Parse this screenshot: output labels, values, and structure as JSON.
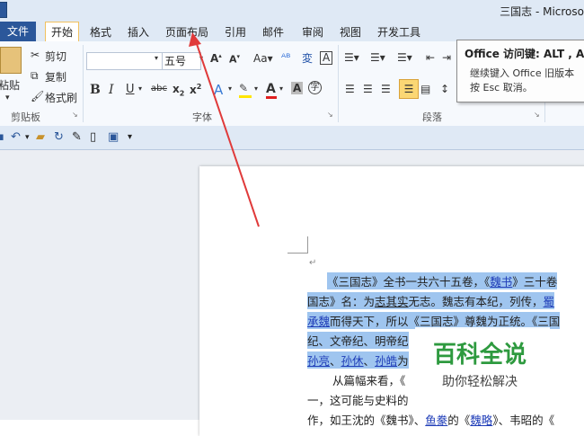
{
  "window": {
    "title": "三国志 - Microso"
  },
  "tabs": [
    "文件",
    "开始",
    "格式",
    "插入",
    "页面布局",
    "引用",
    "邮件",
    "审阅",
    "视图",
    "开发工具"
  ],
  "clipboard": {
    "paste": "粘贴",
    "cut": "剪切",
    "copy": "复制",
    "format_painter": "格式刷",
    "group": "剪贴板"
  },
  "font": {
    "size": "五号",
    "group": "字体"
  },
  "paragraph": {
    "group": "段落"
  },
  "tooltip": {
    "title": "Office 访问键: ALT , A,",
    "line1": "继续键入 Office 旧版本",
    "line2": "按 Esc 取消。"
  },
  "document": {
    "l1a": "《三国志》全书一共六十五卷，《",
    "l1link": "魏书",
    "l1b": "》三十卷",
    "l2a": "国志》名：为",
    "l2b": "志其实",
    "l2c": "无志。魏志有本纪，列传，",
    "l2link": "蜀",
    "l3link": "承魏",
    "l3b": "而得天下，所以《三国志》尊魏为正统。《三国",
    "l4": "纪、文帝纪、明帝纪",
    "l5a": "孙亮",
    "l5b": "、",
    "l5c": "孙休",
    "l5d": "、",
    "l5e": "孙皓",
    "l5f": "为",
    "l6": "从篇幅来看，《",
    "l7": "一，这可能与史料的",
    "l8a": "作，如王沈的《魏书》、",
    "l8link1": "鱼豢",
    "l8b": "的《",
    "l8link2": "魏略",
    "l8c": "》、韦昭的《"
  },
  "watermark": {
    "big": "百科全说",
    "small": "助你轻松解决"
  }
}
